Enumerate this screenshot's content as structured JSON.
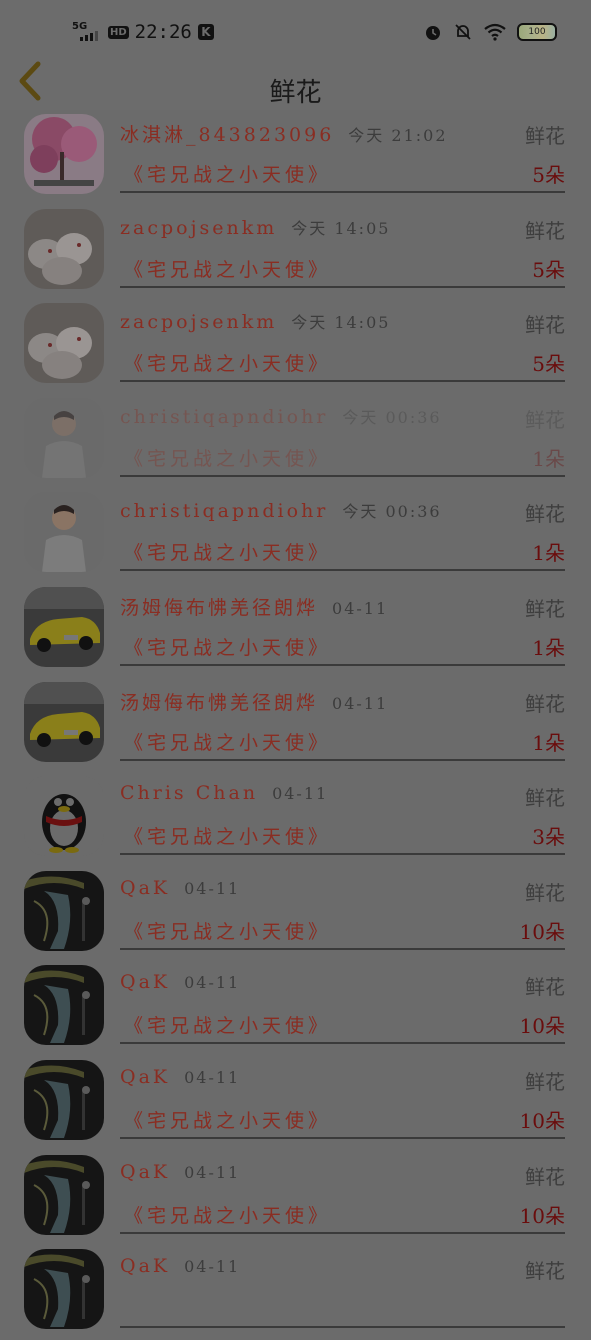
{
  "status_bar": {
    "network": "5G",
    "hd": "HD",
    "time": "22:26",
    "app_badge": "K",
    "battery": "100"
  },
  "nav": {
    "title": "鲜花"
  },
  "rows": [
    {
      "name": "冰淇淋_843823096",
      "time": "今天 21:02",
      "type": "鲜花",
      "item": "《宅兄战之小天使》",
      "qty": "5朵",
      "avatar": "cherry-blossom"
    },
    {
      "name": "zacpojsenkm",
      "time": "今天 14:05",
      "type": "鲜花",
      "item": "《宅兄战之小天使》",
      "qty": "5朵",
      "avatar": "rabbits"
    },
    {
      "name": "zacpojsenkm",
      "time": "今天 14:05",
      "type": "鲜花",
      "item": "《宅兄战之小天使》",
      "qty": "5朵",
      "avatar": "rabbits"
    },
    {
      "name": "christiqapndiohr",
      "time": "今天 00:36",
      "type": "鲜花",
      "item": "《宅兄战之小天使》",
      "qty": "1朵",
      "avatar": "man",
      "faded": true
    },
    {
      "name": "christiqapndiohr",
      "time": "今天 00:36",
      "type": "鲜花",
      "item": "《宅兄战之小天使》",
      "qty": "1朵",
      "avatar": "man"
    },
    {
      "name": "汤姆侮布怫羌径朗烨",
      "time": "04-11",
      "type": "鲜花",
      "item": "《宅兄战之小天使》",
      "qty": "1朵",
      "avatar": "yellow-car"
    },
    {
      "name": "汤姆侮布怫羌径朗烨",
      "time": "04-11",
      "type": "鲜花",
      "item": "《宅兄战之小天使》",
      "qty": "1朵",
      "avatar": "yellow-car"
    },
    {
      "name": "Chris Chan",
      "time": "04-11",
      "type": "鲜花",
      "item": "《宅兄战之小天使》",
      "qty": "3朵",
      "avatar": "penguin"
    },
    {
      "name": "QaK",
      "time": "04-11",
      "type": "鲜花",
      "item": "《宅兄战之小天使》",
      "qty": "10朵",
      "avatar": "crane-painting"
    },
    {
      "name": "QaK",
      "time": "04-11",
      "type": "鲜花",
      "item": "《宅兄战之小天使》",
      "qty": "10朵",
      "avatar": "crane-painting"
    },
    {
      "name": "QaK",
      "time": "04-11",
      "type": "鲜花",
      "item": "《宅兄战之小天使》",
      "qty": "10朵",
      "avatar": "crane-painting"
    },
    {
      "name": "QaK",
      "time": "04-11",
      "type": "鲜花",
      "item": "《宅兄战之小天使》",
      "qty": "10朵",
      "avatar": "crane-painting"
    },
    {
      "name": "QaK",
      "time": "04-11",
      "type": "鲜花",
      "item": "",
      "qty": "",
      "avatar": "crane-painting"
    }
  ]
}
